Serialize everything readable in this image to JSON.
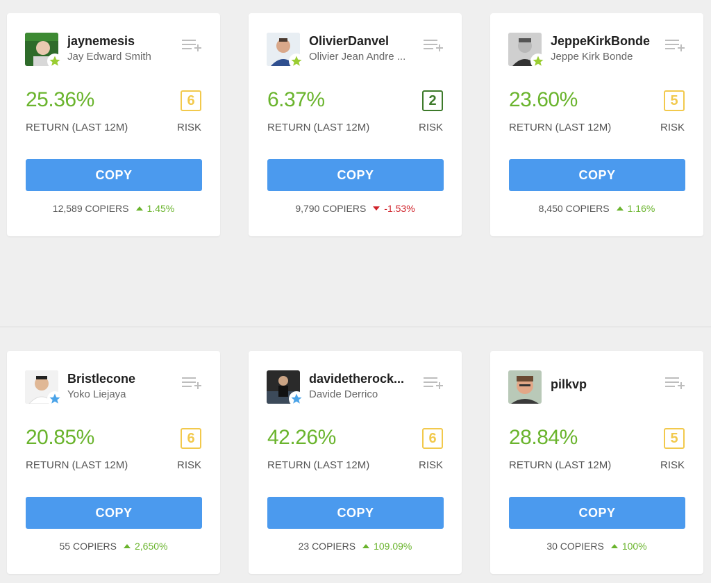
{
  "cards": [
    {
      "username": "jaynemesis",
      "full_name": "Jay Edward Smith",
      "return_value": "25.36%",
      "return_label": "RETURN (LAST 12M)",
      "risk_value": "6",
      "risk_label": "RISK",
      "copy_label": "COPY",
      "copiers": "12,589 COPIERS",
      "change": "1.45%",
      "change_direction": "up",
      "star_color": "#9acd32",
      "risk_color": "#f2c94c"
    },
    {
      "username": "OlivierDanvel",
      "full_name": "Olivier Jean Andre ...",
      "return_value": "6.37%",
      "return_label": "RETURN (LAST 12M)",
      "risk_value": "2",
      "risk_label": "RISK",
      "copy_label": "COPY",
      "copiers": "9,790 COPIERS",
      "change": "-1.53%",
      "change_direction": "down",
      "star_color": "#9acd32",
      "risk_color": "#3d7a2a"
    },
    {
      "username": "JeppeKirkBonde",
      "full_name": "Jeppe Kirk Bonde",
      "return_value": "23.60%",
      "return_label": "RETURN (LAST 12M)",
      "risk_value": "5",
      "risk_label": "RISK",
      "copy_label": "COPY",
      "copiers": "8,450 COPIERS",
      "change": "1.16%",
      "change_direction": "up",
      "star_color": "#9acd32",
      "risk_color": "#f2c94c"
    },
    {
      "username": "Bristlecone",
      "full_name": "Yoko Liejaya",
      "return_value": "20.85%",
      "return_label": "RETURN (LAST 12M)",
      "risk_value": "6",
      "risk_label": "RISK",
      "copy_label": "COPY",
      "copiers": "55 COPIERS",
      "change": "2,650%",
      "change_direction": "up",
      "star_color": "#4aa3e8",
      "risk_color": "#f2c94c"
    },
    {
      "username": "davidetherock...",
      "full_name": "Davide Derrico",
      "return_value": "42.26%",
      "return_label": "RETURN (LAST 12M)",
      "risk_value": "6",
      "risk_label": "RISK",
      "copy_label": "COPY",
      "copiers": "23 COPIERS",
      "change": "109.09%",
      "change_direction": "up",
      "star_color": "#4aa3e8",
      "risk_color": "#f2c94c"
    },
    {
      "username": "pilkvp",
      "full_name": "",
      "return_value": "28.84%",
      "return_label": "RETURN (LAST 12M)",
      "risk_value": "5",
      "risk_label": "RISK",
      "copy_label": "COPY",
      "copiers": "30 COPIERS",
      "change": "100%",
      "change_direction": "up",
      "star_color": "",
      "risk_color": "#f2c94c"
    }
  ],
  "colors": {
    "return_green": "#6ab42d",
    "copy_blue": "#4b9aee",
    "negative_red": "#d0222a"
  }
}
